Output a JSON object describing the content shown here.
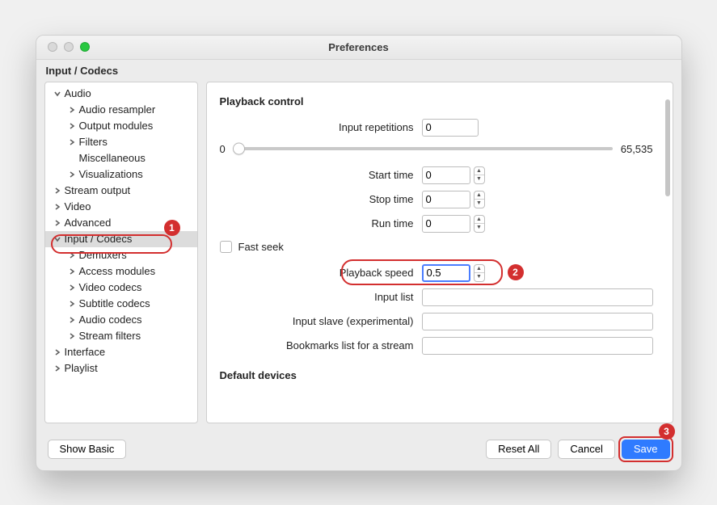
{
  "window": {
    "title": "Preferences"
  },
  "section_title": "Input / Codecs",
  "sidebar": {
    "items": [
      {
        "label": "Audio",
        "level": 0,
        "expanded": true
      },
      {
        "label": "Audio resampler",
        "level": 1,
        "expanded": false
      },
      {
        "label": "Output modules",
        "level": 1,
        "expanded": false
      },
      {
        "label": "Filters",
        "level": 1,
        "expanded": false
      },
      {
        "label": "Miscellaneous",
        "level": 1,
        "leaf": true
      },
      {
        "label": "Visualizations",
        "level": 1,
        "expanded": false
      },
      {
        "label": "Stream output",
        "level": 0,
        "expanded": false
      },
      {
        "label": "Video",
        "level": 0,
        "expanded": false
      },
      {
        "label": "Advanced",
        "level": 0,
        "expanded": false
      },
      {
        "label": "Input / Codecs",
        "level": 0,
        "expanded": true,
        "selected": true
      },
      {
        "label": "Demuxers",
        "level": 1,
        "expanded": false
      },
      {
        "label": "Access modules",
        "level": 1,
        "expanded": false
      },
      {
        "label": "Video codecs",
        "level": 1,
        "expanded": false
      },
      {
        "label": "Subtitle codecs",
        "level": 1,
        "expanded": false
      },
      {
        "label": "Audio codecs",
        "level": 1,
        "expanded": false
      },
      {
        "label": "Stream filters",
        "level": 1,
        "expanded": false
      },
      {
        "label": "Interface",
        "level": 0,
        "expanded": false
      },
      {
        "label": "Playlist",
        "level": 0,
        "expanded": false
      }
    ]
  },
  "content": {
    "heading_playback": "Playback control",
    "labels": {
      "input_repetitions": "Input repetitions",
      "start_time": "Start time",
      "stop_time": "Stop time",
      "run_time": "Run time",
      "fast_seek": "Fast seek",
      "playback_speed": "Playback speed",
      "input_list": "Input list",
      "input_slave": "Input slave (experimental)",
      "bookmarks": "Bookmarks list for a stream"
    },
    "values": {
      "input_repetitions": "0",
      "slider_min": "0",
      "slider_max": "65,535",
      "start_time": "0",
      "stop_time": "0",
      "run_time": "0",
      "fast_seek_checked": false,
      "playback_speed": "0.5",
      "input_list": "",
      "input_slave": "",
      "bookmarks": ""
    },
    "heading_devices": "Default devices"
  },
  "footer": {
    "show_basic": "Show Basic",
    "reset_all": "Reset All",
    "cancel": "Cancel",
    "save": "Save"
  },
  "annotations": {
    "badge1": "1",
    "badge2": "2",
    "badge3": "3"
  }
}
